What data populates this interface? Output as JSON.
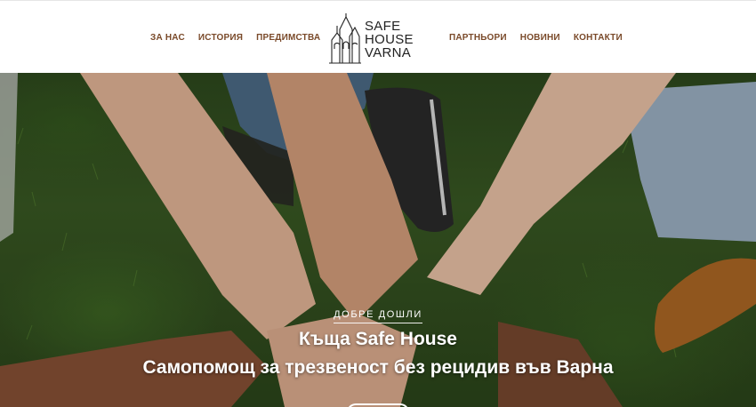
{
  "nav": {
    "left": [
      {
        "label": "ЗА НАС"
      },
      {
        "label": "ИСТОРИЯ"
      },
      {
        "label": "ПРЕДИМСТВА"
      }
    ],
    "right": [
      {
        "label": "ПАРТНЬОРИ"
      },
      {
        "label": "НОВИНИ"
      },
      {
        "label": "КОНТАКТИ"
      }
    ]
  },
  "logo": {
    "line1": "SAFE",
    "line2": "HOUSE",
    "line3": "VARNA",
    "icon": "cathedral-icon"
  },
  "hero": {
    "eyebrow": "ДОБРЕ ДОШЛИ",
    "title": "Къща Safe House",
    "subtitle": "Самопомощ за трезвеност без рецидив във Варна",
    "image": "hands-together-on-grass"
  },
  "colors": {
    "nav_text": "#7a4a2a",
    "logo_text": "#222222",
    "hero_text": "#ffffff"
  }
}
